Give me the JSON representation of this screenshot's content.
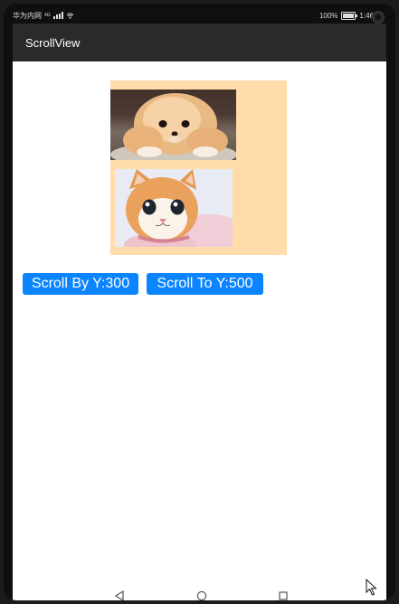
{
  "status_bar": {
    "carrier": "华为内网",
    "network_badge": "4G",
    "battery_percent": "100%",
    "time": "1:46",
    "icons": [
      "signal-icon",
      "wifi-icon",
      "battery-icon"
    ]
  },
  "app_bar": {
    "title": "ScrollView"
  },
  "scroll_view": {
    "images": [
      "pomeranian-dog-photo",
      "orange-kitten-photo"
    ],
    "background_color": "#ffdcaa"
  },
  "buttons": {
    "scroll_by_label": "Scroll By Y:300",
    "scroll_to_label": "Scroll To Y:500",
    "color": "#0a84ff"
  },
  "nav_bar": {
    "icons": [
      "back-icon",
      "home-icon",
      "recent-apps-icon"
    ]
  }
}
